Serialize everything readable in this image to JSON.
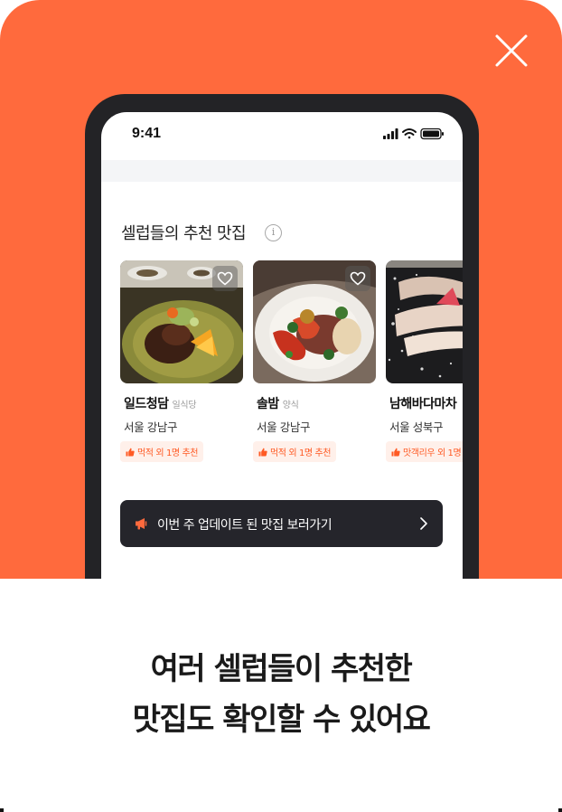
{
  "colors": {
    "accent": "#ff6a3d",
    "badge_text": "#ff5a24",
    "badge_bg": "#fff0ea",
    "cta_bg": "#25252b",
    "phone_frame": "#232326"
  },
  "status_bar": {
    "time": "9:41",
    "icons": [
      "signal-icon",
      "wifi-icon",
      "battery-icon"
    ]
  },
  "section": {
    "title": "셀럽들의 추천 맛집",
    "info_glyph": "i"
  },
  "restaurants": [
    {
      "name": "일드청담",
      "category": "일식당",
      "location": "서울 강남구",
      "badge": "먹적 외 1명 추천"
    },
    {
      "name": "솔밤",
      "category": "양식",
      "location": "서울 강남구",
      "badge": "먹적 외 1명 추천"
    },
    {
      "name": "남해바다마차",
      "category": "",
      "location": "서울 성북구",
      "badge": "맛객리우 외 1명"
    }
  ],
  "cta": {
    "label": "이번 주 업데이트 된 맛집 보러가기"
  },
  "headline": {
    "line1": "여러 셀럽들이 추천한",
    "line2": "맛집도 확인할 수 있어요"
  }
}
